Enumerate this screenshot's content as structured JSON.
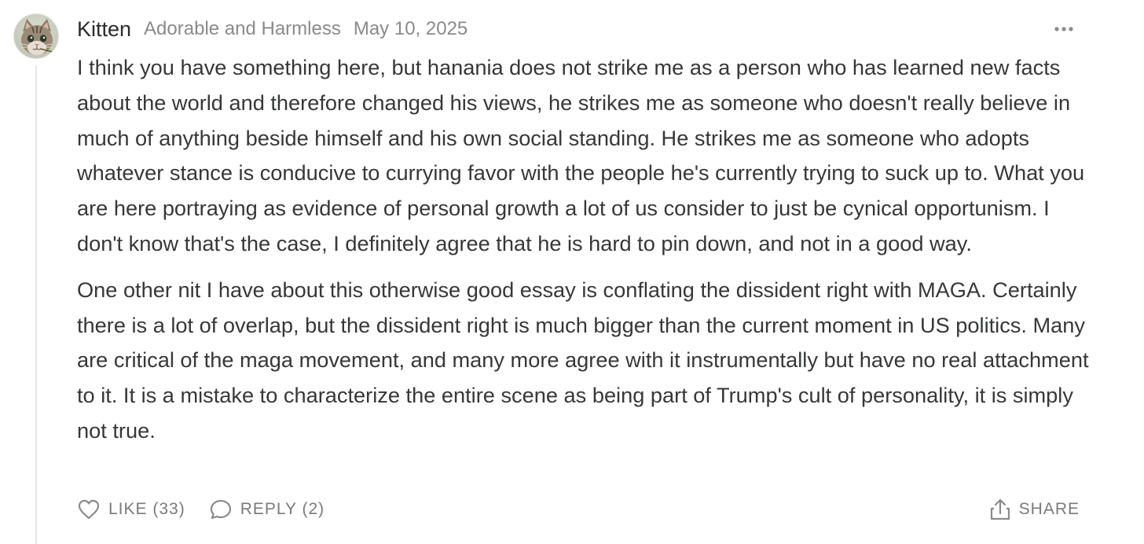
{
  "comment": {
    "author": "Kitten",
    "subtitle": "Adorable and Harmless",
    "date": "May 10, 2025",
    "paragraphs": [
      "I think you have something here, but hanania does not strike me as a person who has learned new facts about the world and therefore changed his views, he strikes me as someone who doesn't really believe in much of anything beside himself and his own social standing. He strikes me as someone who adopts whatever stance is conducive to currying favor with the people he's currently trying to suck up to. What you are here portraying as evidence of personal growth a lot of us consider to just be cynical opportunism. I don't know that's the case, I definitely agree that he is hard to pin down, and not in a good way.",
      "One other nit I have about this otherwise good essay is conflating the dissident right with MAGA. Certainly there is a lot of overlap, but the dissident right is much bigger than the current moment in US politics. Many are critical of the maga movement, and many more agree with it instrumentally but have no real attachment to it. It is a mistake to characterize the entire scene as being part of Trump's cult of personality, it is simply not true."
    ]
  },
  "actions": {
    "like_label": "LIKE (33)",
    "reply_label": "REPLY (2)",
    "share_label": "SHARE"
  },
  "icons": {
    "avatar": "cat-avatar",
    "more": "more-options-icon",
    "like": "heart-icon",
    "reply": "speech-bubble-icon",
    "share": "share-icon"
  }
}
